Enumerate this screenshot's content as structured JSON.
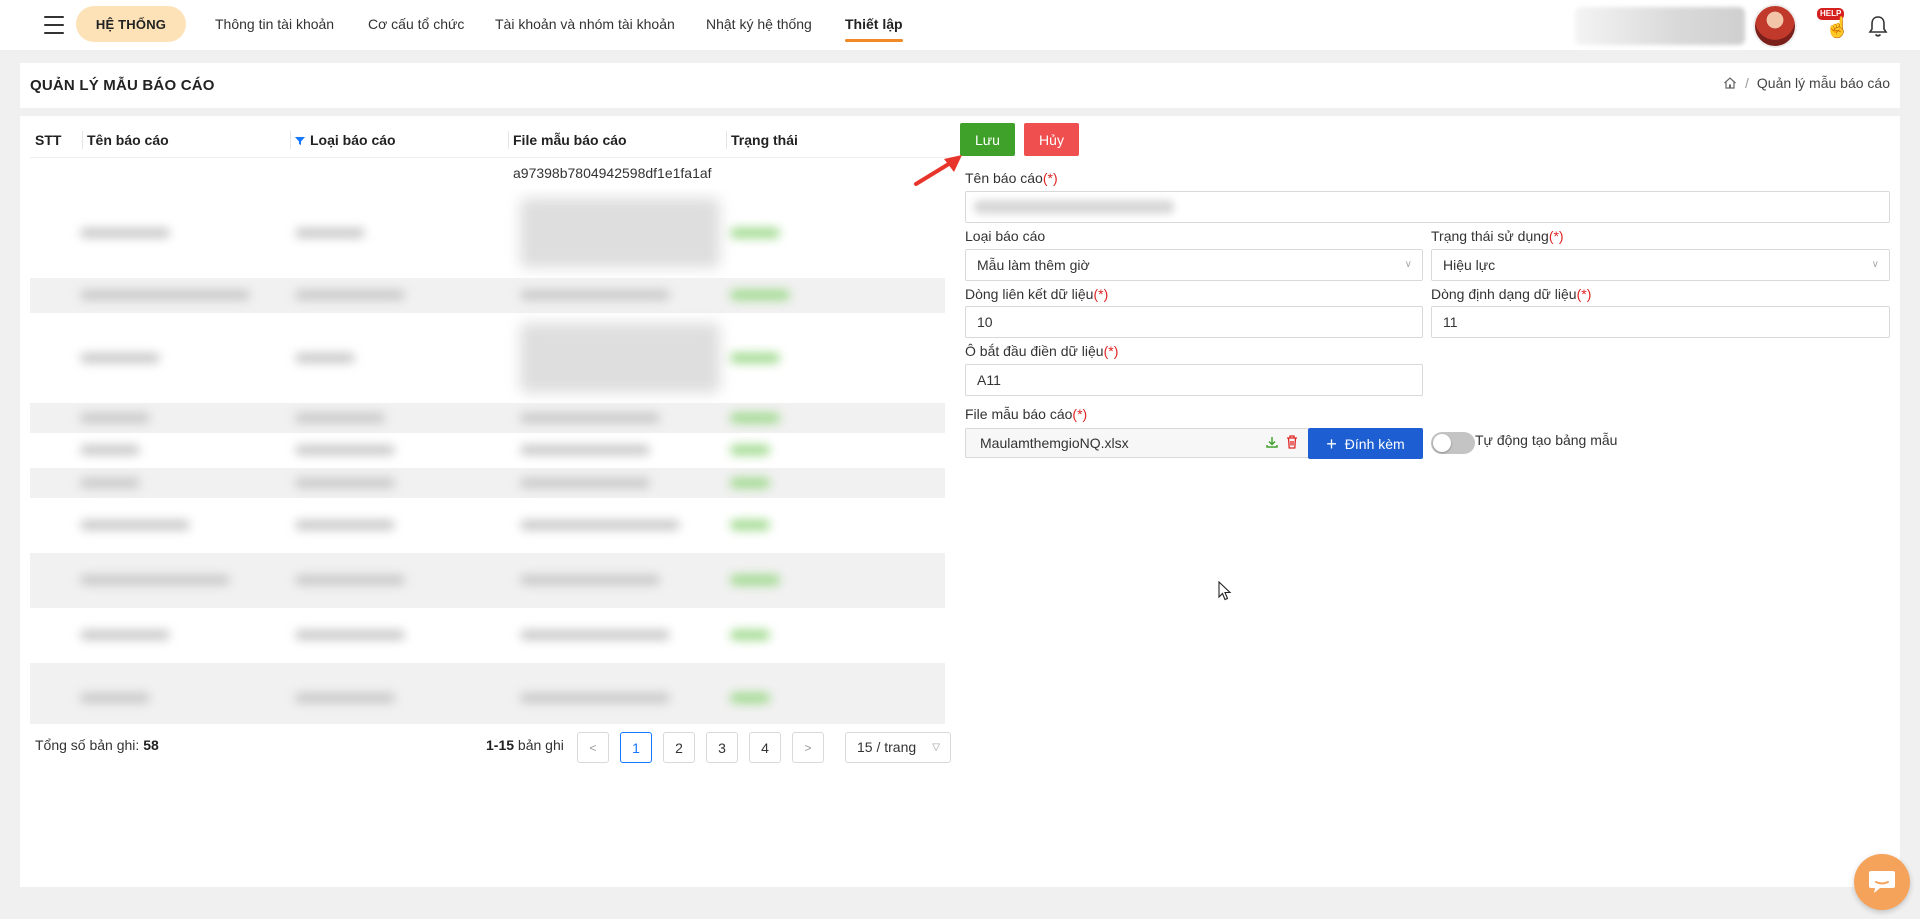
{
  "topbar": {
    "system_label": "HỆ THỐNG",
    "nav": [
      {
        "label": "Thông tin tài khoản"
      },
      {
        "label": "Cơ cấu tổ chức"
      },
      {
        "label": "Tài khoản và nhóm tài khoản"
      },
      {
        "label": "Nhật ký hệ thống"
      },
      {
        "label": "Thiết lập",
        "active": true
      }
    ],
    "help_badge": "HELP"
  },
  "header": {
    "title": "QUẢN LÝ MẪU BÁO CÁO",
    "breadcrumb_current": "Quản lý mẫu báo cáo"
  },
  "table": {
    "columns": [
      "STT",
      "Tên báo cáo",
      "Loại báo cáo",
      "File mẫu báo cáo",
      "Trạng thái"
    ],
    "first_row_file": "a97398b7804942598df1e1fa1af"
  },
  "pagination": {
    "total_label": "Tổng số bản ghi:",
    "total": "58",
    "range": "1-15",
    "range_suffix": "bản ghi",
    "pages": [
      "1",
      "2",
      "3",
      "4"
    ],
    "current_page": "1",
    "page_size": "15 / trang"
  },
  "form": {
    "save_label": "Lưu",
    "cancel_label": "Hủy",
    "name_label": "Tên báo cáo",
    "type_label": "Loại báo cáo",
    "type_value": "Mẫu làm thêm giờ",
    "status_label": "Trạng thái sử dụng",
    "status_value": "Hiệu lực",
    "link_row_label": "Dòng liên kết dữ liệu",
    "link_row_value": "10",
    "format_row_label": "Dòng định dạng dữ liệu",
    "format_row_value": "11",
    "start_cell_label": "Ô bắt đầu điền dữ liệu",
    "start_cell_value": "A11",
    "file_label": "File mẫu báo cáo",
    "file_name": "MaulamthemgioNQ.xlsx",
    "attach_label": "Đính kèm",
    "auto_label": "Tự động tạo bảng mẫu",
    "required_mark": "(*)"
  },
  "colors": {
    "accent": "#f08a24",
    "save": "#3fa02a",
    "cancel": "#f04f50",
    "attach": "#1d5fd2",
    "active_page": "#1677ff"
  }
}
